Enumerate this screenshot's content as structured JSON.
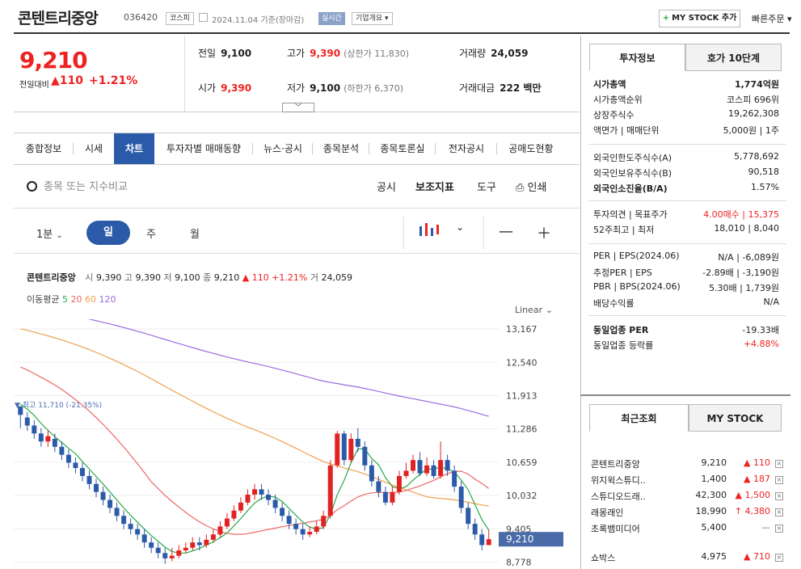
{
  "header": {
    "stock_name": "콘텐트리중앙",
    "code": "036420",
    "market_tag": "코스피",
    "date": "2024.11.04 기준(장마감)",
    "realtime": "실시간",
    "corp_info": "기업개요",
    "mystock_btn": "MY STOCK 추가",
    "quick_order": "빠른주문"
  },
  "price": {
    "current": "9,210",
    "prev_label": "전일대비",
    "change": "▲110",
    "percent": "+1.21%"
  },
  "quotes": {
    "prev_label": "전일",
    "prev": "9,100",
    "high_label": "고가",
    "high": "9,390",
    "upper_limit": "(상한가 11,830)",
    "volume_label": "거래량",
    "volume": "24,059",
    "open_label": "시가",
    "open": "9,390",
    "low_label": "저가",
    "low": "9,100",
    "lower_limit": "(하한가 6,370)",
    "amount_label": "거래대금",
    "amount": "222 백만"
  },
  "tabs": [
    "종합정보",
    "시세",
    "차트",
    "투자자별 매매동향",
    "뉴스·공시",
    "종목분석",
    "종목토론실",
    "전자공시",
    "공매도현황"
  ],
  "tools": {
    "search_placeholder": "종목 또는 지수비교",
    "notice": "공시",
    "indicator": "보조지표",
    "tool": "도구",
    "print": "인쇄"
  },
  "periods": [
    "1분",
    "일",
    "주",
    "월"
  ],
  "chart_info": {
    "name": "콘텐트리중앙",
    "open_k": "시",
    "open": "9,390",
    "high_k": "고",
    "high": "9,390",
    "low_k": "저",
    "low": "9,100",
    "close_k": "종",
    "close": "9,210",
    "change": "▲ 110 +1.21%",
    "vol_k": "거",
    "vol": "24,059",
    "ma_label": "이동평균",
    "ma5": "5",
    "ma20": "20",
    "ma60": "60",
    "ma120": "120",
    "scale": "Linear",
    "high_marker": "▼ 최고 11,710 (-21.35%)"
  },
  "chart_data": {
    "type": "candlestick",
    "y_ticks": [
      "13,167",
      "12,540",
      "11,913",
      "11,286",
      "10,659",
      "10,032",
      "9,405",
      "8,778"
    ],
    "ylim": [
      8650,
      13350
    ],
    "last_price_label": "9,210",
    "candles": [
      [
        11710,
        11550,
        11710,
        11300
      ],
      [
        11500,
        11350,
        11600,
        11250
      ],
      [
        11350,
        11200,
        11450,
        11100
      ],
      [
        11200,
        11050,
        11300,
        10950
      ],
      [
        11050,
        11150,
        11250,
        10950
      ],
      [
        11100,
        10950,
        11200,
        10850
      ],
      [
        10950,
        10800,
        11050,
        10700
      ],
      [
        10800,
        10650,
        10900,
        10550
      ],
      [
        10650,
        10550,
        10750,
        10450
      ],
      [
        10550,
        10400,
        10650,
        10300
      ],
      [
        10400,
        10250,
        10500,
        10150
      ],
      [
        10250,
        10100,
        10350,
        10000
      ],
      [
        10100,
        9950,
        10200,
        9850
      ],
      [
        9950,
        9800,
        10050,
        9700
      ],
      [
        9800,
        9650,
        9900,
        9550
      ],
      [
        9650,
        9500,
        9750,
        9400
      ],
      [
        9500,
        9400,
        9600,
        9300
      ],
      [
        9400,
        9300,
        9500,
        9200
      ],
      [
        9300,
        9150,
        9400,
        9050
      ],
      [
        9150,
        9050,
        9250,
        8950
      ],
      [
        9050,
        8950,
        9150,
        8850
      ],
      [
        8950,
        8850,
        9050,
        8750
      ],
      [
        8850,
        8900,
        9050,
        8800
      ],
      [
        8900,
        9000,
        9100,
        8850
      ],
      [
        9000,
        9050,
        9150,
        8950
      ],
      [
        9050,
        9150,
        9250,
        9000
      ],
      [
        9150,
        9100,
        9250,
        9000
      ],
      [
        9100,
        9200,
        9300,
        9050
      ],
      [
        9200,
        9300,
        9400,
        9150
      ],
      [
        9300,
        9450,
        9550,
        9250
      ],
      [
        9450,
        9600,
        9700,
        9400
      ],
      [
        9600,
        9750,
        9850,
        9550
      ],
      [
        9750,
        9900,
        10000,
        9700
      ],
      [
        9900,
        10050,
        10150,
        9850
      ],
      [
        10050,
        10150,
        10250,
        9950
      ],
      [
        10150,
        10050,
        10250,
        9950
      ],
      [
        10050,
        9950,
        10150,
        9850
      ],
      [
        9950,
        9800,
        10050,
        9700
      ],
      [
        9800,
        9650,
        9900,
        9550
      ],
      [
        9650,
        9500,
        9750,
        9400
      ],
      [
        9500,
        9400,
        9600,
        9300
      ],
      [
        9400,
        9300,
        9500,
        9200
      ],
      [
        9300,
        9350,
        9450,
        9250
      ],
      [
        9350,
        9450,
        9550,
        9300
      ],
      [
        9450,
        9650,
        9750,
        9400
      ],
      [
        9650,
        10600,
        10700,
        9600
      ],
      [
        10600,
        11200,
        11250,
        10550
      ],
      [
        11200,
        10700,
        11250,
        10600
      ],
      [
        10700,
        11100,
        11200,
        10650
      ],
      [
        11100,
        10950,
        11300,
        10850
      ],
      [
        10950,
        10600,
        11050,
        10500
      ],
      [
        10600,
        10300,
        10700,
        10200
      ],
      [
        10300,
        10100,
        10400,
        10000
      ],
      [
        10100,
        9900,
        10200,
        9850
      ],
      [
        9900,
        10100,
        10200,
        9850
      ],
      [
        10100,
        10400,
        10500,
        10050
      ],
      [
        10400,
        10500,
        10650,
        10350
      ],
      [
        10500,
        10700,
        10800,
        10450
      ],
      [
        10700,
        10450,
        10850,
        10400
      ],
      [
        10450,
        10600,
        10750,
        10400
      ],
      [
        10600,
        10400,
        10700,
        10350
      ],
      [
        10400,
        10700,
        11050,
        10350
      ],
      [
        10700,
        10500,
        10800,
        10400
      ],
      [
        10500,
        10200,
        10600,
        10100
      ],
      [
        10200,
        9800,
        10300,
        9700
      ],
      [
        9800,
        9500,
        9900,
        9400
      ],
      [
        9500,
        9300,
        9600,
        9200
      ],
      [
        9300,
        9100,
        9400,
        9000
      ],
      [
        9100,
        9210,
        9390,
        9100
      ]
    ]
  },
  "invest": {
    "tab1": "투자정보",
    "tab2": "호가 10단계",
    "rows": [
      {
        "label": "시가총액",
        "value": "1,774억원",
        "bold": true
      },
      {
        "label": "시가총액순위",
        "value": "코스피 696위"
      },
      {
        "label": "상장주식수",
        "value": "19,262,308"
      },
      {
        "label": "액면가 | 매매단위",
        "value": "5,000원 | 1주"
      },
      {
        "label": "외국인한도주식수(A)",
        "value": "5,778,692"
      },
      {
        "label": "외국인보유주식수(B)",
        "value": "90,518"
      },
      {
        "label": "외국인소진율(B/A)",
        "value": "1.57%",
        "bold": true
      },
      {
        "label": "투자의견 | 목표주가",
        "value": "4.00매수 | 15,375"
      },
      {
        "label": "52주최고 | 최저",
        "value": "18,010 | 8,040"
      },
      {
        "label": "PER | EPS(2024.06)",
        "value": "N/A | -6,089원"
      },
      {
        "label": "추정PER | EPS",
        "value": "-2.89배 | -3,190원"
      },
      {
        "label": "PBR | BPS(2024.06)",
        "value": "5.30배 | 1,739원"
      },
      {
        "label": "배당수익률",
        "value": "N/A"
      },
      {
        "label": "동일업종 PER",
        "value": "-19.33배",
        "bold": true
      },
      {
        "label": "동일업종 등락률",
        "value": "+4.88%"
      }
    ]
  },
  "recent": {
    "tab1": "최근조회",
    "tab2": "MY STOCK",
    "items": [
      {
        "name": "콘텐트리중앙",
        "price": "9,210",
        "change": "▲ 110"
      },
      {
        "name": "위지윅스튜디..",
        "price": "1,400",
        "change": "▲ 187"
      },
      {
        "name": "스튜디오드래..",
        "price": "42,300",
        "change": "▲ 1,500"
      },
      {
        "name": "래몽래인",
        "price": "18,990",
        "change": "↑ 4,380"
      },
      {
        "name": "초록뱀미디어",
        "price": "5,400",
        "change": "—"
      },
      {
        "name": "쇼박스",
        "price": "4,975",
        "change": "▲ 710"
      }
    ]
  },
  "colors": {
    "up": "#e22222",
    "down": "#2b5aa8",
    "ma5": "#2aa84a",
    "ma20": "#e66",
    "ma60": "#f0a050",
    "ma120": "#9a6be0"
  }
}
